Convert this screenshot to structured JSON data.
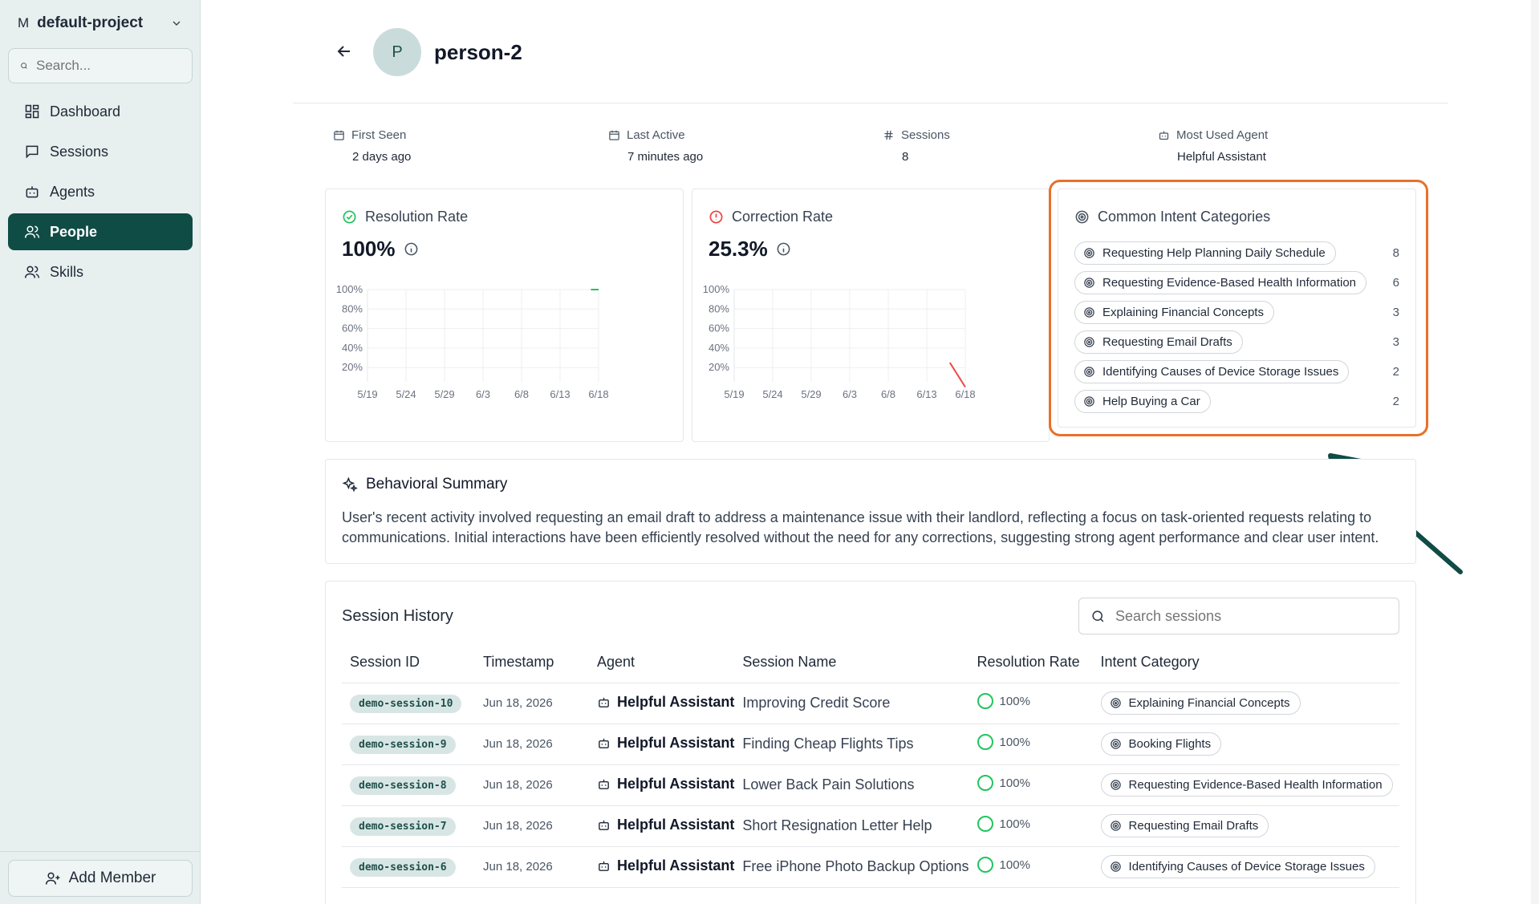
{
  "sidebar": {
    "project_initial": "M",
    "project_name": "default-project",
    "search_placeholder": "Search...",
    "nav": [
      {
        "label": "Dashboard",
        "icon": "dashboard-icon"
      },
      {
        "label": "Sessions",
        "icon": "message-icon"
      },
      {
        "label": "Agents",
        "icon": "bot-icon"
      },
      {
        "label": "People",
        "icon": "people-icon",
        "active": true
      },
      {
        "label": "Skills",
        "icon": "people-icon"
      }
    ],
    "add_member_label": "Add Member"
  },
  "header": {
    "avatar_initial": "P",
    "title": "person-2"
  },
  "stats": {
    "first_seen": {
      "label": "First Seen",
      "value": "2 days ago"
    },
    "last_active": {
      "label": "Last Active",
      "value": "7 minutes ago"
    },
    "sessions": {
      "label": "Sessions",
      "value": "8"
    },
    "most_used_agent": {
      "label": "Most Used Agent",
      "value": "Helpful Assistant"
    }
  },
  "resolution": {
    "title": "Resolution Rate",
    "value": "100%"
  },
  "correction": {
    "title": "Correction Rate",
    "value": "25.3%"
  },
  "chart_data": [
    {
      "type": "line",
      "title": "Resolution Rate",
      "x": [
        "5/19",
        "5/24",
        "5/29",
        "6/3",
        "6/8",
        "6/13",
        "6/18"
      ],
      "y_ticks": [
        "100%",
        "80%",
        "60%",
        "40%",
        "20%"
      ],
      "ylim": [
        0,
        100
      ],
      "series": [
        {
          "color": "#22c55e",
          "points": [
            {
              "x": "6/17",
              "y": 100
            },
            {
              "x": "6/18",
              "y": 100
            }
          ]
        }
      ],
      "grid": true
    },
    {
      "type": "line",
      "title": "Correction Rate",
      "x": [
        "5/19",
        "5/24",
        "5/29",
        "6/3",
        "6/8",
        "6/13",
        "6/18"
      ],
      "y_ticks": [
        "100%",
        "80%",
        "60%",
        "40%",
        "20%"
      ],
      "ylim": [
        0,
        100
      ],
      "series": [
        {
          "color": "#ef4444",
          "points": [
            {
              "x": "6/16",
              "y": 25
            },
            {
              "x": "6/18",
              "y": 0
            }
          ]
        }
      ],
      "grid": true
    }
  ],
  "intents": {
    "title": "Common Intent Categories",
    "items": [
      {
        "label": "Requesting Help Planning Daily Schedule",
        "count": "8"
      },
      {
        "label": "Requesting Evidence-Based Health Information",
        "count": "6"
      },
      {
        "label": "Explaining Financial Concepts",
        "count": "3"
      },
      {
        "label": "Requesting Email Drafts",
        "count": "3"
      },
      {
        "label": "Identifying Causes of Device Storage Issues",
        "count": "2"
      },
      {
        "label": "Help Buying a Car",
        "count": "2"
      }
    ]
  },
  "summary": {
    "title": "Behavioral Summary",
    "text": "User's recent activity involved requesting an email draft to address a maintenance issue with their landlord, reflecting a focus on task-oriented requests relating to communications. Initial interactions have been efficiently resolved without the need for any corrections, suggesting strong agent performance and clear user intent."
  },
  "session_history": {
    "title": "Session History",
    "search_placeholder": "Search sessions",
    "columns": [
      "Session ID",
      "Timestamp",
      "Agent",
      "Session Name",
      "Resolution Rate",
      "Intent Category"
    ],
    "rows": [
      {
        "id": "demo-session-10",
        "timestamp": "Jun 18, 2026",
        "agent": "Helpful Assistant",
        "name": "Improving Credit Score",
        "rate": "100%",
        "intent": "Explaining Financial Concepts"
      },
      {
        "id": "demo-session-9",
        "timestamp": "Jun 18, 2026",
        "agent": "Helpful Assistant",
        "name": "Finding Cheap Flights Tips",
        "rate": "100%",
        "intent": "Booking Flights"
      },
      {
        "id": "demo-session-8",
        "timestamp": "Jun 18, 2026",
        "agent": "Helpful Assistant",
        "name": "Lower Back Pain Solutions",
        "rate": "100%",
        "intent": "Requesting Evidence-Based Health Information"
      },
      {
        "id": "demo-session-7",
        "timestamp": "Jun 18, 2026",
        "agent": "Helpful Assistant",
        "name": "Short Resignation Letter Help",
        "rate": "100%",
        "intent": "Requesting Email Drafts"
      },
      {
        "id": "demo-session-6",
        "timestamp": "Jun 18, 2026",
        "agent": "Helpful Assistant",
        "name": "Free iPhone Photo Backup Options",
        "rate": "100%",
        "intent": "Identifying Causes of Device Storage Issues"
      }
    ]
  }
}
